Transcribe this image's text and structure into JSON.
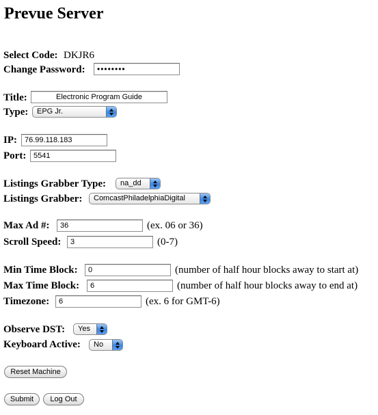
{
  "page_title": "Prevue Server",
  "select_code": {
    "label": "Select Code:",
    "value": "DKJR6"
  },
  "change_password": {
    "label": "Change Password:",
    "value": "••••••••"
  },
  "title_field": {
    "label": "Title:",
    "value": "Electronic Program Guide"
  },
  "type_field": {
    "label": "Type:",
    "value": "EPG Jr."
  },
  "ip_field": {
    "label": "IP:",
    "value": "76.99.118.183"
  },
  "port_field": {
    "label": "Port:",
    "value": "5541"
  },
  "listings_grabber_type": {
    "label": "Listings Grabber Type:",
    "value": "na_dd"
  },
  "listings_grabber": {
    "label": "Listings Grabber:",
    "value": "ComcastPhiladelphiaDigital"
  },
  "max_ad": {
    "label": "Max Ad #:",
    "value": "36",
    "hint": "(ex. 06 or 36)"
  },
  "scroll_speed": {
    "label": "Scroll Speed:",
    "value": "3",
    "hint": "(0-7)"
  },
  "min_time_block": {
    "label": "Min Time Block:",
    "value": "0",
    "hint": "(number of half hour blocks away to start at)"
  },
  "max_time_block": {
    "label": "Max Time Block:",
    "value": "6",
    "hint": "(number of half hour blocks away to end at)"
  },
  "timezone": {
    "label": "Timezone:",
    "value": "6",
    "hint": "(ex. 6 for GMT-6)"
  },
  "observe_dst": {
    "label": "Observe DST:",
    "value": "Yes"
  },
  "keyboard_active": {
    "label": "Keyboard Active:",
    "value": "No"
  },
  "buttons": {
    "reset_machine": "Reset Machine",
    "submit": "Submit",
    "log_out": "Log Out"
  }
}
